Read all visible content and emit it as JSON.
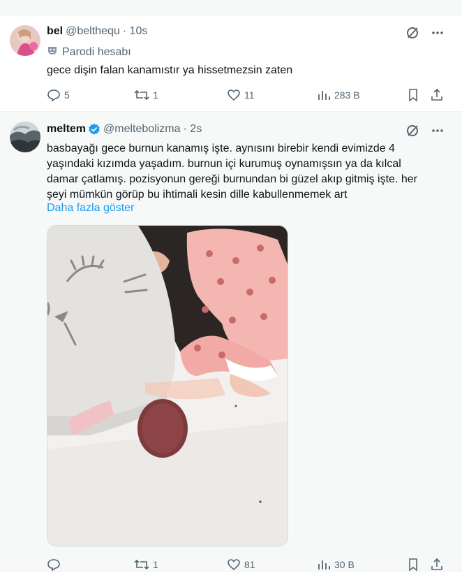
{
  "tweets": [
    {
      "name": "bel",
      "handle": "@belthequ",
      "time": "· 10s",
      "parody_label": "Parodi hesabı",
      "text": "gece dişin falan kanamıstır ya hissetmezsin zaten",
      "actions": {
        "replies": "5",
        "reposts": "1",
        "likes": "11",
        "views": "283 B"
      }
    },
    {
      "name": "meltem",
      "handle": "@meltebolizma",
      "time": "· 2s",
      "verified": true,
      "text_lines": [
        "basbayağı gece burnun kanamış işte. aynısını birebir kendi evimizde 4",
        "yaşındaki kızımda yaşadım. burnun içi kurumuş oynamışsın ya da kılcal",
        "damar çatlamış. pozisyonun gereği burnundan bi güzel akıp gitmiş işte. her",
        "şeyi mümkün görüp bu ihtimali kesin dille kabullenmemek art"
      ],
      "show_more": "Daha fazla göster",
      "actions": {
        "replies": "",
        "reposts": "1",
        "likes": "81",
        "views": "30 B"
      }
    }
  ],
  "colors": {
    "accent": "#1d9bf0",
    "muted": "#536471",
    "text": "#0f1419"
  }
}
